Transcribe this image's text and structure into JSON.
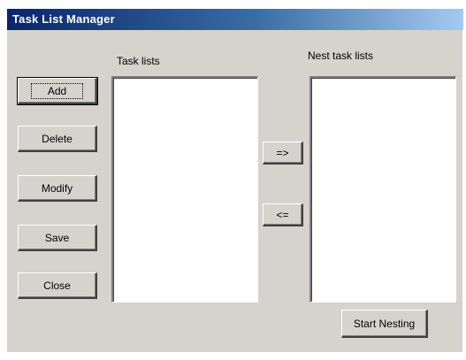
{
  "window": {
    "title": "Task List Manager"
  },
  "labels": {
    "task_lists": "Task lists",
    "nest_task_lists": "Nest task lists"
  },
  "buttons": {
    "add": "Add",
    "delete": "Delete",
    "modify": "Modify",
    "save": "Save",
    "close": "Close",
    "move_right": "=>",
    "move_left": "<=",
    "start_nesting": "Start Nesting"
  },
  "lists": {
    "task_lists_items": [],
    "nest_task_lists_items": []
  }
}
